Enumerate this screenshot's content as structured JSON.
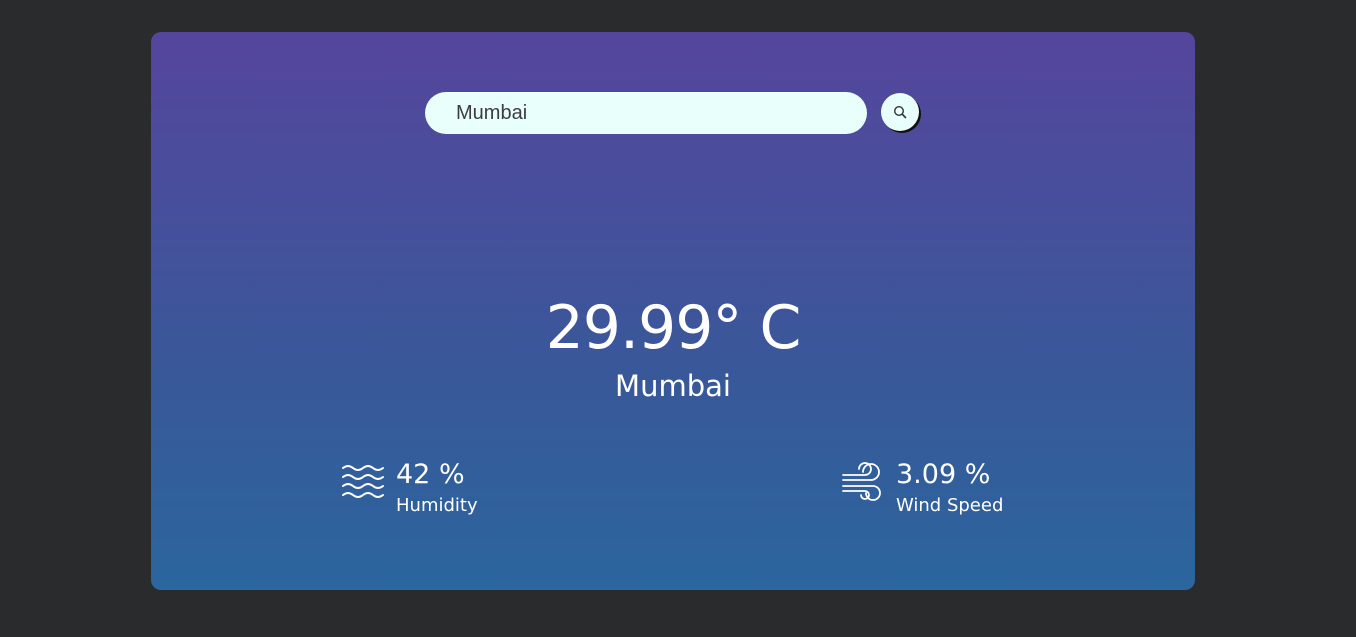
{
  "search": {
    "value": "Mumbai"
  },
  "weather": {
    "temperature": "29.99° C",
    "city": "Mumbai"
  },
  "humidity": {
    "value": "42 %",
    "label": "Humidity",
    "icon": "humidity-waves-icon"
  },
  "wind": {
    "value": "3.09 %",
    "label": "Wind Speed",
    "icon": "wind-icon"
  },
  "colors": {
    "background": "#2a2b2d",
    "card_top": "#55459d",
    "card_bottom": "#2b669e",
    "input_bg": "#e8fffb",
    "text": "#ffffff"
  }
}
